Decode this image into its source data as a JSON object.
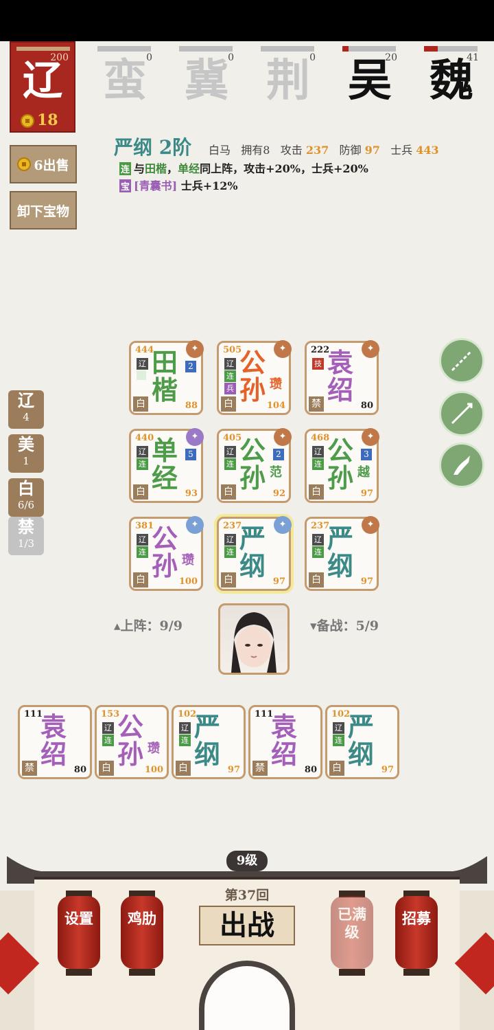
{
  "player": {
    "hp": "200",
    "faction": "辽",
    "coins": "18"
  },
  "enemies": [
    {
      "name": "蛮",
      "num": "0",
      "fill": 0,
      "color": "#c6c6c6"
    },
    {
      "name": "冀",
      "num": "0",
      "fill": 0,
      "color": "#c6c6c6"
    },
    {
      "name": "荆",
      "num": "0",
      "fill": 0,
      "color": "#c6c6c6"
    },
    {
      "name": "吴",
      "num": "20",
      "fill": 0.12,
      "color": "#111111"
    },
    {
      "name": "魏",
      "num": "41",
      "fill": 0.25,
      "color": "#111111"
    }
  ],
  "side_buttons": {
    "sell": "6出售",
    "unequip": "卸下宝物"
  },
  "info": {
    "title": "严纲 2阶",
    "mount": "白马",
    "own_label": "拥有8",
    "attack_label": "攻击",
    "attack": "237",
    "defense_label": "防御",
    "defense": "97",
    "soldier_label": "士兵",
    "soldier": "443",
    "line2_tag": "连",
    "line2_pre": "与",
    "line2_a": "田楷",
    "line2_sep": "，",
    "line2_b": "单经",
    "line2_post": "同上阵，攻击+20%，士兵+20%",
    "line3_tag": "宝",
    "line3_item": "[青囊书]",
    "line3_post": " 士兵+12%"
  },
  "factions": [
    {
      "name": "辽",
      "count": "4"
    },
    {
      "name": "美",
      "count": "1"
    },
    {
      "name": "白",
      "count": "6/6"
    },
    {
      "name": "禁",
      "count": "1/3"
    }
  ],
  "formation": [
    {
      "hp": "444",
      "c1": "田",
      "c2": "楷",
      "sub": "",
      "grade": "白",
      "val": "88",
      "color": "#4e9b4a",
      "level": "2"
    },
    {
      "hp": "505",
      "c1": "公",
      "c2": "孙",
      "sub": "瓒",
      "grade": "白",
      "val": "104",
      "color": "#e4622a",
      "level": ""
    },
    {
      "hp": "222",
      "c1": "袁",
      "c2": "绍",
      "sub": "",
      "grade": "禁",
      "val": "80",
      "color": "#a45fb8",
      "level": ""
    },
    {
      "hp": "440",
      "c1": "单",
      "c2": "经",
      "sub": "",
      "grade": "白",
      "val": "93",
      "color": "#4e9b4a",
      "level": "5"
    },
    {
      "hp": "405",
      "c1": "公",
      "c2": "孙",
      "sub": "范",
      "grade": "白",
      "val": "92",
      "color": "#4e9b4a",
      "level": "2"
    },
    {
      "hp": "468",
      "c1": "公",
      "c2": "孙",
      "sub": "越",
      "grade": "白",
      "val": "97",
      "color": "#4e9b4a",
      "level": "3"
    },
    {
      "hp": "381",
      "c1": "公",
      "c2": "孙",
      "sub": "瓒",
      "grade": "白",
      "val": "100",
      "color": "#a45fb8",
      "level": ""
    },
    {
      "hp": "237",
      "c1": "严",
      "c2": "纲",
      "sub": "",
      "grade": "白",
      "val": "97",
      "color": "#3c8a88",
      "level": ""
    },
    {
      "hp": "237",
      "c1": "严",
      "c2": "纲",
      "sub": "",
      "grade": "白",
      "val": "97",
      "color": "#3c8a88",
      "level": ""
    }
  ],
  "field_status": {
    "onfield": "▴上阵：9/9",
    "reserve": "▾备战：5/9"
  },
  "reserve_units": [
    {
      "hp": "111",
      "c1": "袁",
      "c2": "绍",
      "sub": "",
      "grade": "禁",
      "val": "80",
      "color": "#a45fb8"
    },
    {
      "hp": "153",
      "c1": "公",
      "c2": "孙",
      "sub": "瓒",
      "grade": "白",
      "val": "100",
      "color": "#a45fb8"
    },
    {
      "hp": "102",
      "c1": "严",
      "c2": "纲",
      "sub": "",
      "grade": "白",
      "val": "97",
      "color": "#3c8a88"
    },
    {
      "hp": "111",
      "c1": "袁",
      "c2": "绍",
      "sub": "",
      "grade": "禁",
      "val": "80",
      "color": "#a45fb8"
    },
    {
      "hp": "102",
      "c1": "严",
      "c2": "纲",
      "sub": "",
      "grade": "白",
      "val": "97",
      "color": "#3c8a88"
    }
  ],
  "bottom": {
    "level": "9级",
    "round": "第37回",
    "battle": "出战",
    "settings": "设置",
    "chicken": "鸡肋",
    "maxed": "已满级",
    "recruit": "招募"
  },
  "badge_labels": {
    "ligao": "辽",
    "lian": "连",
    "bing": "兵",
    "ji": "技"
  }
}
